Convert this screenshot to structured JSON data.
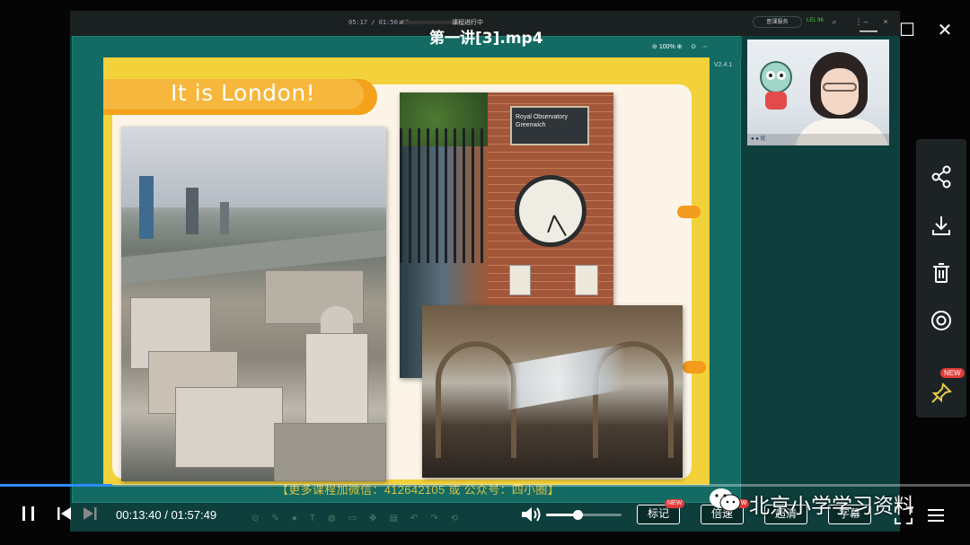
{
  "window": {
    "file_title": "第一讲[3].mp4",
    "minimize_glyph": "—",
    "maximize_glyph": "☐",
    "close_glyph": "✕"
  },
  "recording": {
    "time": "05:17 / 01:50:00",
    "status": "课程进行中",
    "right_button": "医课服务",
    "signal": "LEL 96",
    "progress": 0.05
  },
  "courseware": {
    "zoom": "100%",
    "version": "V2.4.1",
    "slide_title": "It is London!",
    "clock_sign_line1": "Royal Observatory",
    "clock_sign_line2": "Greenwich",
    "watermark": "【更多课程加微信：412642105 或 公众号：四小圈】"
  },
  "webcam": {
    "footer": "● ● 优"
  },
  "player": {
    "time": "00:13:40 / 01:57:49",
    "progress": 0.116,
    "volume": 0.42,
    "buttons": [
      {
        "label": "标记",
        "badge": "NEW"
      },
      {
        "label": "倍速",
        "badge": "NEW"
      },
      {
        "label": "超清",
        "badge": ""
      },
      {
        "label": "字幕",
        "badge": ""
      }
    ]
  },
  "side_actions": {
    "items": [
      "share-icon",
      "download-icon",
      "delete-icon",
      "settings-icon",
      "pin-icon"
    ],
    "pin_badge": "NEW"
  },
  "brand_watermark": "北京小学学习资料",
  "colors": {
    "accent_blue": "#2c8cff",
    "panel_teal": "#136b63",
    "slide_yellow": "#f2d13a",
    "banner_orange": "#f4a21c",
    "badge_red": "#e23b3b"
  }
}
